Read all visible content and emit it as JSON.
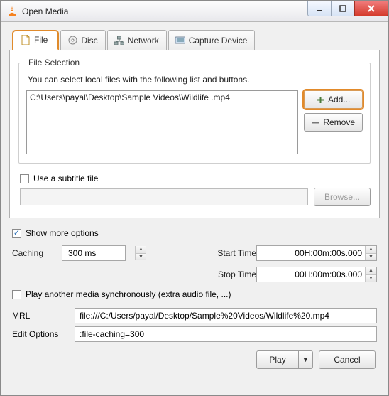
{
  "window": {
    "title": "Open Media"
  },
  "tabs": {
    "file": "File",
    "disc": "Disc",
    "network": "Network",
    "capture": "Capture Device"
  },
  "file_selection": {
    "legend": "File Selection",
    "hint": "You can select local files with the following list and buttons.",
    "items": [
      "C:\\Users\\payal\\Desktop\\Sample Videos\\Wildlife .mp4"
    ],
    "add_label": "Add...",
    "remove_label": "Remove"
  },
  "subtitle": {
    "checkbox_label": "Use a subtitle file",
    "browse_label": "Browse...",
    "path": ""
  },
  "more_options": {
    "label": "Show more options"
  },
  "options": {
    "caching_label": "Caching",
    "caching_value": "300 ms",
    "start_label": "Start Time",
    "start_value": "00H:00m:00s.000",
    "stop_label": "Stop Time",
    "stop_value": "00H:00m:00s.000"
  },
  "sync": {
    "label": "Play another media synchronously (extra audio file, ...)"
  },
  "mrl": {
    "label": "MRL",
    "value": "file:///C:/Users/payal/Desktop/Sample%20Videos/Wildlife%20.mp4"
  },
  "edit_options": {
    "label": "Edit Options",
    "value": ":file-caching=300"
  },
  "footer": {
    "play": "Play",
    "cancel": "Cancel"
  }
}
